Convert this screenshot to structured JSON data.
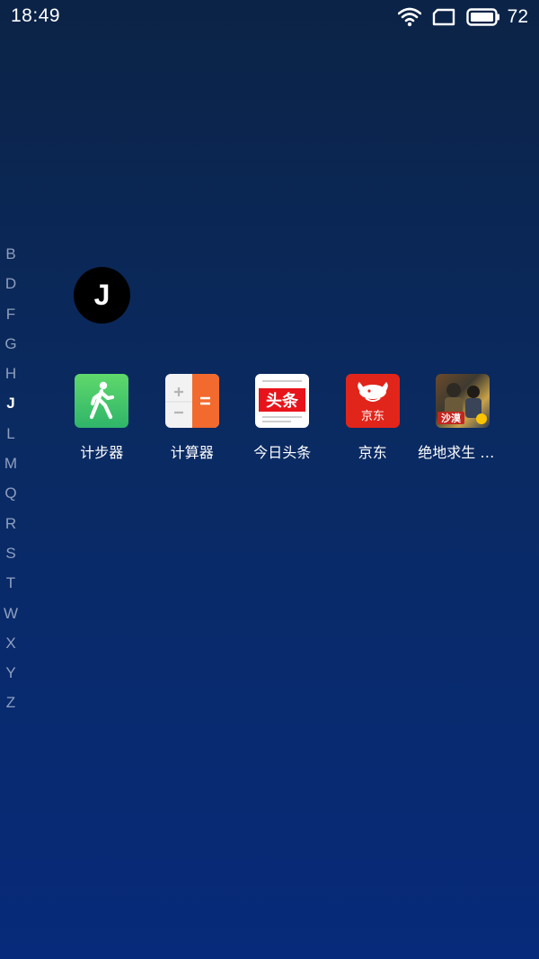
{
  "status_bar": {
    "time": "18:49",
    "battery_level": "72",
    "icons": [
      "wifi-icon",
      "sim-card-icon",
      "battery-icon"
    ]
  },
  "alphabet_index": {
    "letters": [
      "B",
      "D",
      "F",
      "G",
      "H",
      "J",
      "L",
      "M",
      "Q",
      "R",
      "S",
      "T",
      "W",
      "X",
      "Y",
      "Z"
    ],
    "active": "J"
  },
  "section": {
    "letter": "J"
  },
  "apps": [
    {
      "label": "计步器",
      "icon": "pedometer-icon"
    },
    {
      "label": "计算器",
      "icon": "calculator-icon"
    },
    {
      "label": "今日头条",
      "icon": "toutiao-icon",
      "icon_text": "头条"
    },
    {
      "label": "京东",
      "icon": "jd-icon",
      "icon_text": "京东"
    },
    {
      "label": "绝地求生 刺激战场",
      "icon": "pubg-icon",
      "icon_text": "沙漠"
    }
  ],
  "colors": {
    "background_top": "#0b2346",
    "background_bottom": "#072a7a",
    "jd_red": "#e1251b",
    "calc_orange": "#f26a2e",
    "pedometer_green": "#3fc46a"
  }
}
